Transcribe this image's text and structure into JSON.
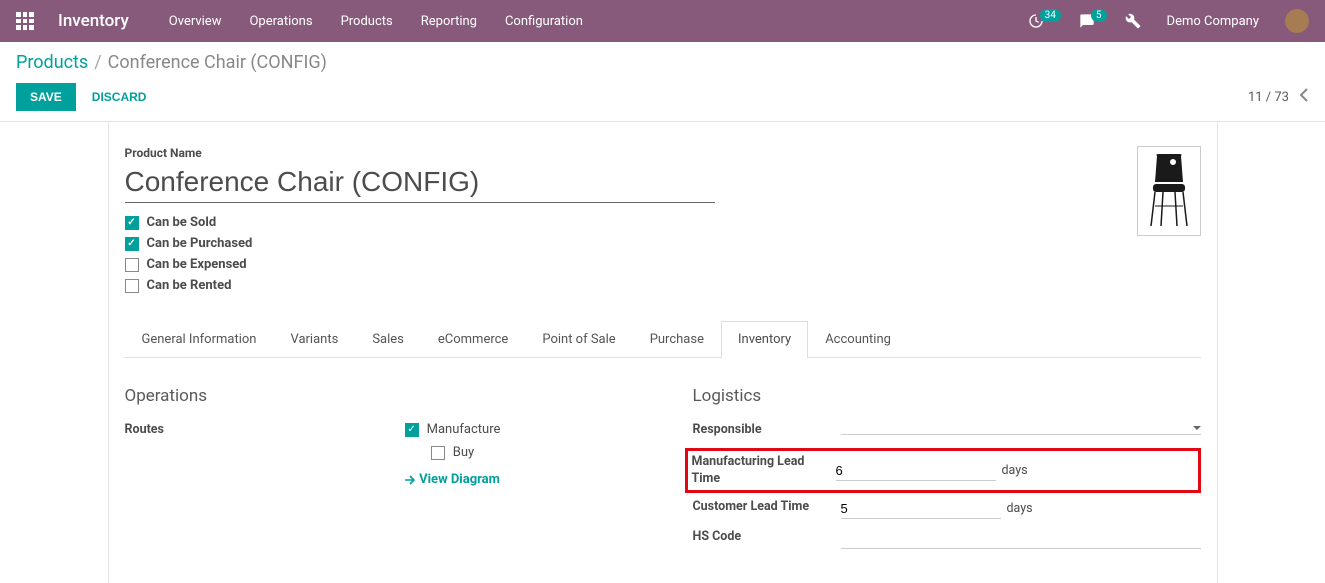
{
  "navbar": {
    "brand": "Inventory",
    "menu": [
      "Overview",
      "Operations",
      "Products",
      "Reporting",
      "Configuration"
    ],
    "activity_count": "34",
    "message_count": "5",
    "company": "Demo Company"
  },
  "breadcrumb": {
    "root": "Products",
    "sep": "/",
    "current": "Conference Chair (CONFIG)"
  },
  "actions": {
    "save": "SAVE",
    "discard": "DISCARD"
  },
  "pager": {
    "text": "11 / 73"
  },
  "product": {
    "name_label": "Product Name",
    "name": "Conference Chair (CONFIG)",
    "checks": [
      {
        "label": "Can be Sold",
        "checked": true
      },
      {
        "label": "Can be Purchased",
        "checked": true
      },
      {
        "label": "Can be Expensed",
        "checked": false
      },
      {
        "label": "Can be Rented",
        "checked": false
      }
    ]
  },
  "tabs": [
    "General Information",
    "Variants",
    "Sales",
    "eCommerce",
    "Point of Sale",
    "Purchase",
    "Inventory",
    "Accounting"
  ],
  "active_tab_index": 6,
  "operations": {
    "title": "Operations",
    "routes_label": "Routes",
    "routes": [
      {
        "label": "Manufacture",
        "checked": true
      },
      {
        "label": "Buy",
        "checked": false
      }
    ],
    "view_diagram": "View Diagram"
  },
  "logistics": {
    "title": "Logistics",
    "responsible_label": "Responsible",
    "mfg_lead_label": "Manufacturing Lead Time",
    "mfg_lead_value": "6",
    "cust_lead_label": "Customer Lead Time",
    "cust_lead_value": "5",
    "days_unit": "days",
    "hs_code_label": "HS Code"
  }
}
